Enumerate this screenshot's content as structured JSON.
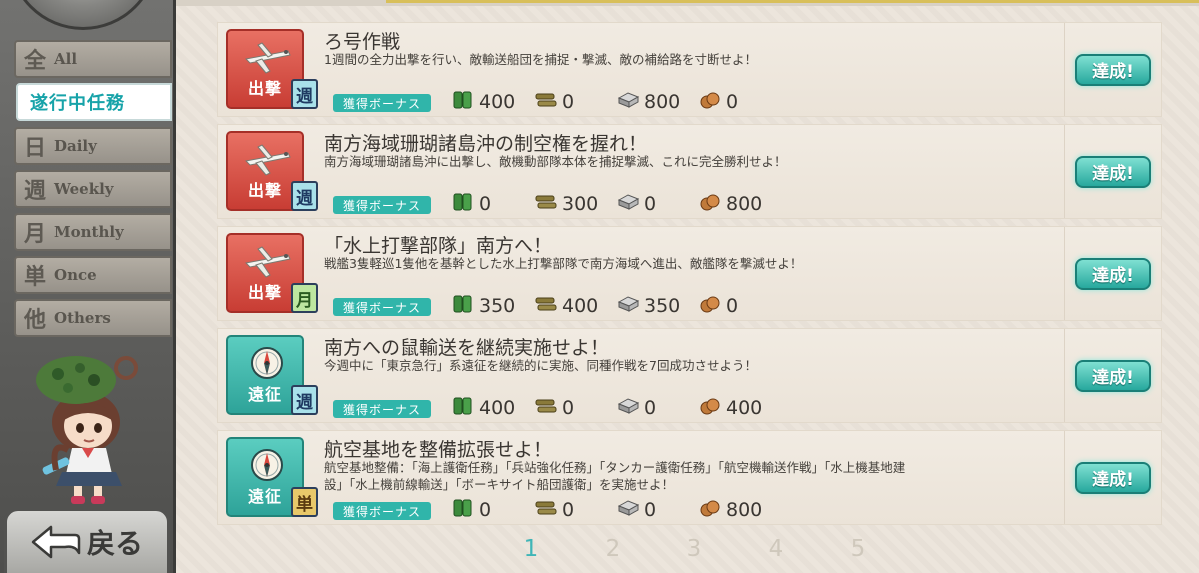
{
  "sidebar": {
    "tabs": [
      {
        "kanji": "全",
        "label": "All"
      },
      {
        "label": "遂行中任務"
      },
      {
        "kanji": "日",
        "label": "Daily"
      },
      {
        "kanji": "週",
        "label": "Weekly"
      },
      {
        "kanji": "月",
        "label": "Monthly"
      },
      {
        "kanji": "単",
        "label": "Once"
      },
      {
        "kanji": "他",
        "label": "Others"
      }
    ],
    "back_label": "戻る"
  },
  "quests": [
    {
      "category": "出撃",
      "category_type": "sortie",
      "frequency": "週",
      "frequency_type": "weekly",
      "title": "ろ号作戦",
      "description": "1週間の全力出撃を行い、敵輸送船団を捕捉・撃滅、敵の補給路を寸断せよ！",
      "bonus_label": "獲得ボーナス",
      "fuel": "400",
      "ammo": "0",
      "steel": "800",
      "bauxite": "0",
      "status": "達成!"
    },
    {
      "category": "出撃",
      "category_type": "sortie",
      "frequency": "週",
      "frequency_type": "weekly",
      "title": "南方海域珊瑚諸島沖の制空権を握れ！",
      "description": "南方海域珊瑚諸島沖に出撃し、敵機動部隊本体を捕捉撃滅、これに完全勝利せよ！",
      "bonus_label": "獲得ボーナス",
      "fuel": "0",
      "ammo": "300",
      "steel": "0",
      "bauxite": "800",
      "status": "達成!"
    },
    {
      "category": "出撃",
      "category_type": "sortie",
      "frequency": "月",
      "frequency_type": "monthly",
      "title": "「水上打撃部隊」南方へ！",
      "description": "戦艦3隻軽巡1隻他を基幹とした水上打撃部隊で南方海域へ進出、敵艦隊を撃滅せよ！",
      "bonus_label": "獲得ボーナス",
      "fuel": "350",
      "ammo": "400",
      "steel": "350",
      "bauxite": "0",
      "status": "達成!"
    },
    {
      "category": "遠征",
      "category_type": "expedition",
      "frequency": "週",
      "frequency_type": "weekly",
      "title": "南方への鼠輸送を継続実施せよ！",
      "description": "今週中に「東京急行」系遠征を継続的に実施、同種作戦を7回成功させよう！",
      "bonus_label": "獲得ボーナス",
      "fuel": "400",
      "ammo": "0",
      "steel": "0",
      "bauxite": "400",
      "status": "達成!"
    },
    {
      "category": "遠征",
      "category_type": "expedition",
      "frequency": "単",
      "frequency_type": "once",
      "title": "航空基地を整備拡張せよ！",
      "description": "航空基地整備：「海上護衛任務」「兵站強化任務」「タンカー護衛任務」「航空機輸送作戦」「水上機基地建設」「水上機前線輸送」「ボーキサイト船団護衛」を実施せよ！",
      "bonus_label": "獲得ボーナス",
      "fuel": "0",
      "ammo": "0",
      "steel": "0",
      "bauxite": "800",
      "status": "達成!"
    }
  ],
  "pagination": {
    "pages": [
      "1",
      "2",
      "3",
      "4",
      "5"
    ],
    "current": "1"
  },
  "colors": {
    "accent": "#30b5aa",
    "sortie": "#d9473d",
    "expedition": "#2ea399",
    "page_current": "#3fb5b7"
  }
}
